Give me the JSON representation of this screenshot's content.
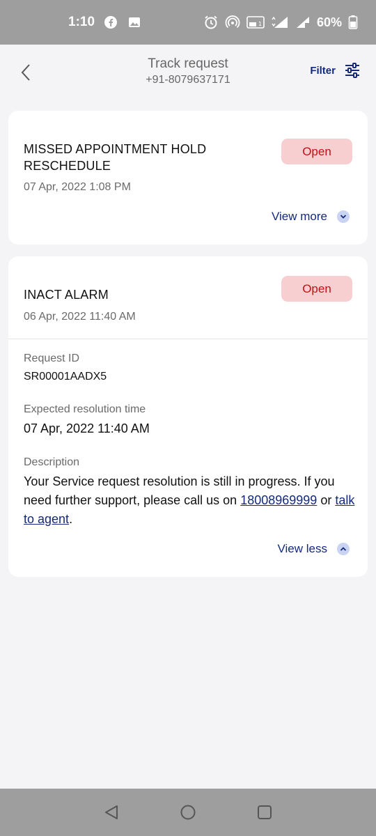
{
  "status_bar": {
    "time": "1:10",
    "battery": "60%",
    "icons": [
      "facebook-icon",
      "image-icon",
      "alarm-icon",
      "hotspot-icon",
      "volte-icon",
      "4g-signal-icon",
      "roaming-signal-icon",
      "battery-icon"
    ]
  },
  "header": {
    "title": "Track request",
    "subtitle": "+91-8079637171",
    "filter_label": "Filter"
  },
  "requests": [
    {
      "title": "MISSED APPOINTMENT HOLD RESCHEDULE",
      "date": "07 Apr, 2022  1:08 PM",
      "status": "Open",
      "toggle_label": "View more"
    },
    {
      "title": "INACT ALARM",
      "date": "06 Apr, 2022  11:40 AM",
      "status": "Open",
      "request_id_label": "Request ID",
      "request_id": "SR00001AADX5",
      "resolution_label": "Expected resolution time",
      "resolution_time": "07 Apr, 2022  11:40 AM",
      "description_label": "Description",
      "description_text": "Your Service request resolution is still in progress. If you need further support, please call us on ",
      "phone_link": "18008969999",
      "or_text": " or ",
      "agent_link": "talk to agent",
      "end_text": ".",
      "toggle_label": "View less"
    }
  ],
  "colors": {
    "accent": "#142a7a",
    "badge_bg": "#f8cfd0",
    "badge_text": "#c20f14",
    "background": "#f4f4f6",
    "system_bar": "#9e9e9e"
  }
}
